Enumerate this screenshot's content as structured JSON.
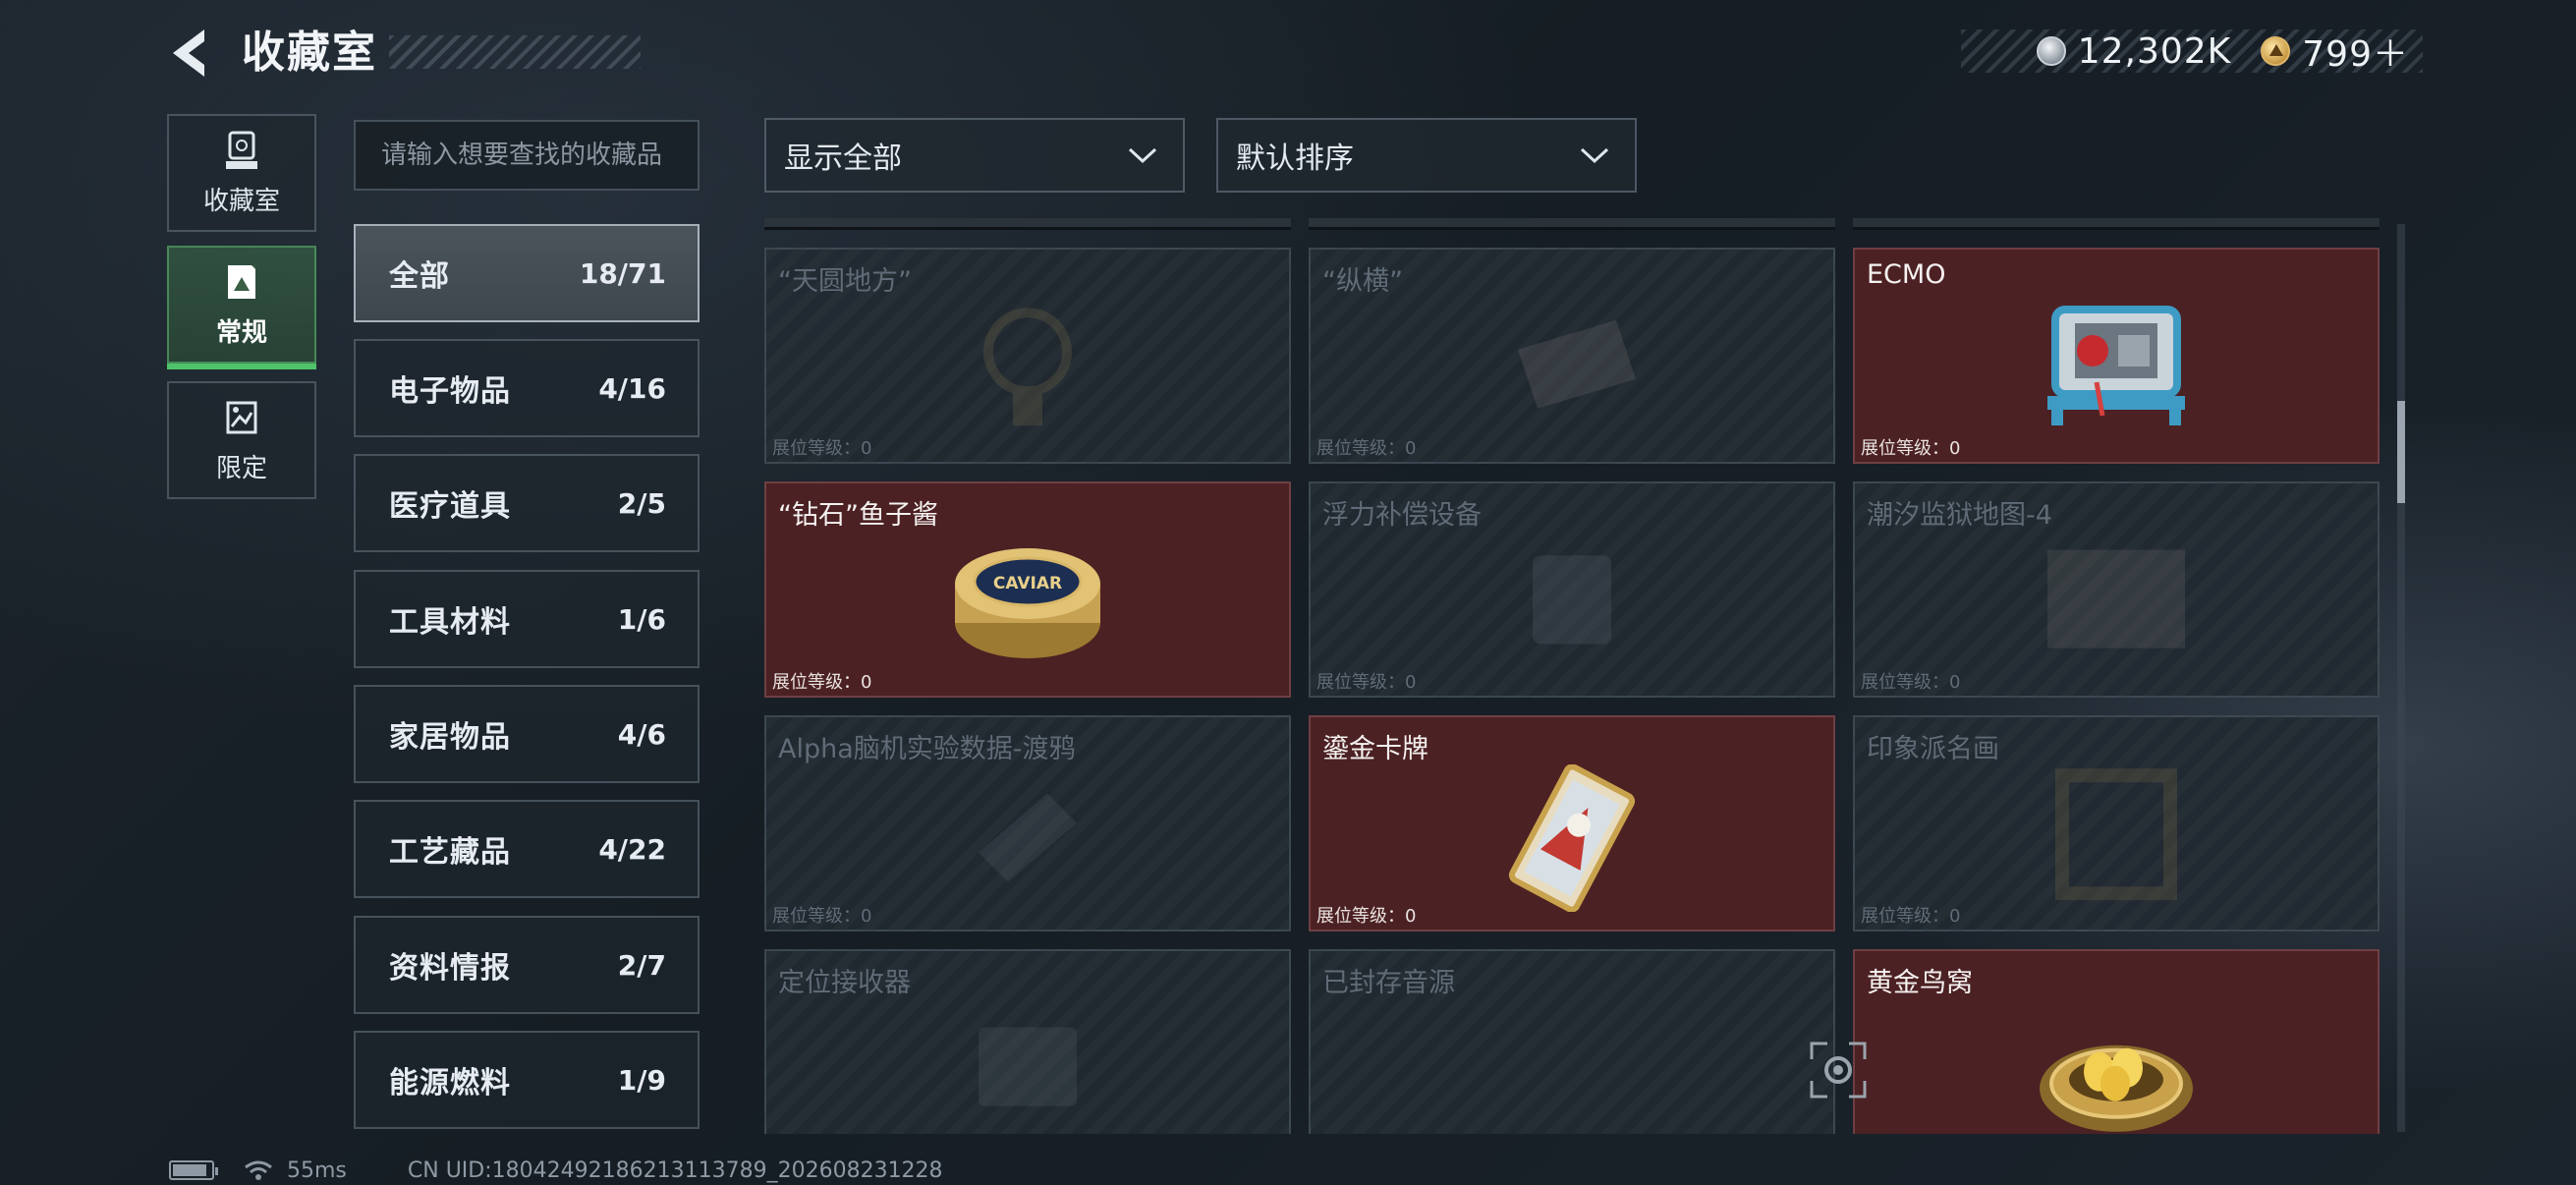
{
  "header": {
    "title": "收藏室"
  },
  "currency": {
    "silver": {
      "value": "12,302K",
      "icon": "silver-coin-icon"
    },
    "gold": {
      "value": "799＋",
      "icon": "gold-coin-icon"
    }
  },
  "left_nav": [
    {
      "label": "收藏室",
      "icon": "collection-room-icon",
      "active": false
    },
    {
      "label": "常规",
      "icon": "regular-icon",
      "active": true
    },
    {
      "label": "限定",
      "icon": "limited-icon",
      "active": false
    }
  ],
  "search": {
    "placeholder": "请输入想要查找的收藏品",
    "value": ""
  },
  "filters": {
    "show": "显示全部",
    "sort": "默认排序"
  },
  "categories": [
    {
      "name": "全部",
      "count": "18/71",
      "active": true
    },
    {
      "name": "电子物品",
      "count": "4/16"
    },
    {
      "name": "医疗道具",
      "count": "2/5"
    },
    {
      "name": "工具材料",
      "count": "1/6"
    },
    {
      "name": "家居物品",
      "count": "4/6"
    },
    {
      "name": "工艺藏品",
      "count": "4/22"
    },
    {
      "name": "资料情报",
      "count": "2/7"
    },
    {
      "name": "能源燃料",
      "count": "1/9"
    }
  ],
  "items": [
    {
      "name": "“天圆地方”",
      "level": "展位等级：0",
      "owned": false
    },
    {
      "name": "“纵横”",
      "level": "展位等级：0",
      "owned": false
    },
    {
      "name": "ECMO",
      "level": "展位等级：0",
      "owned": true
    },
    {
      "name": "“钻石”鱼子酱",
      "level": "展位等级：0",
      "owned": true,
      "label": "CAVIAR"
    },
    {
      "name": "浮力补偿设备",
      "level": "展位等级：0",
      "owned": false
    },
    {
      "name": "潮汐监狱地图-4",
      "level": "展位等级：0",
      "owned": false
    },
    {
      "name": "Alpha脑机实验数据-渡鸦",
      "level": "展位等级：0",
      "owned": false
    },
    {
      "name": "鎏金卡牌",
      "level": "展位等级：0",
      "owned": true
    },
    {
      "name": "印象派名画",
      "level": "展位等级：0",
      "owned": false
    },
    {
      "name": "定位接收器",
      "level": "",
      "owned": false
    },
    {
      "name": "已封存音源",
      "level": "",
      "owned": false
    },
    {
      "name": "黄金鸟窝",
      "level": "",
      "owned": true
    }
  ],
  "scrollbar": {
    "position_fraction": 0.22
  },
  "status_bar": {
    "ping": "55ms",
    "uid": "CN UID:18042492186213113789_202608231228"
  },
  "colors": {
    "owned_card": "#4c2123",
    "active_tab": "#4fc36a"
  }
}
